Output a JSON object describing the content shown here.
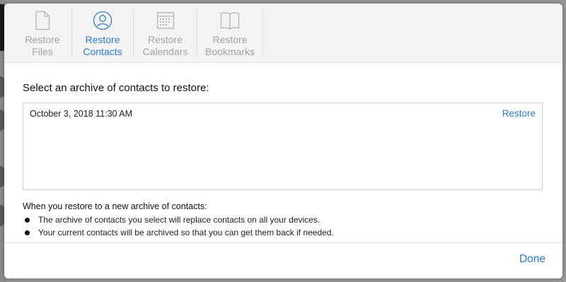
{
  "tabs": [
    {
      "label": "Restore\nFiles",
      "icon": "file-icon",
      "active": false
    },
    {
      "label": "Restore\nContacts",
      "icon": "contacts-icon",
      "active": true
    },
    {
      "label": "Restore\nCalendars",
      "icon": "calendar-icon",
      "active": false
    },
    {
      "label": "Restore\nBookmarks",
      "icon": "bookmarks-icon",
      "active": false
    }
  ],
  "main": {
    "heading": "Select an archive of contacts to restore:",
    "archives": [
      {
        "date": "October 3, 2018 11:30 AM",
        "action": "Restore"
      }
    ],
    "notes_title": "When you restore to a new archive of contacts:",
    "notes": [
      "The archive of contacts you select will replace contacts on all your devices.",
      "Your current contacts will be archived so that you can get them back if needed."
    ]
  },
  "footer": {
    "done_label": "Done"
  },
  "colors": {
    "accent": "#2f7bd0",
    "inactive": "#a3a3a3",
    "toolbar_bg": "#f4f2f2"
  }
}
